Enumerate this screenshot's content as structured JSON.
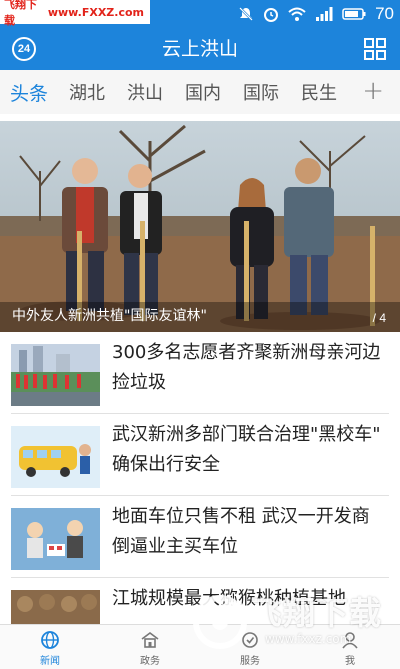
{
  "watermark_top": {
    "name": "飞翔下载",
    "url": "www.FXXZ.com"
  },
  "status_bar": {
    "battery": "70"
  },
  "header": {
    "title": "云上洪山",
    "badge": "24"
  },
  "tabs": [
    {
      "label": "头条",
      "active": true
    },
    {
      "label": "湖北"
    },
    {
      "label": "洪山"
    },
    {
      "label": "国内"
    },
    {
      "label": "国际"
    },
    {
      "label": "民生"
    }
  ],
  "tabs_more": "+",
  "hero": {
    "caption": "中外友人新洲共植\"国际友谊林\"",
    "index": "/ 4"
  },
  "news": [
    {
      "title": "300多名志愿者齐聚新洲母亲河边捡垃圾"
    },
    {
      "title": "武汉新洲多部门联合治理\"黑校车\" 确保出行安全"
    },
    {
      "title": "地面车位只售不租 武汉一开发商倒逼业主买车位"
    },
    {
      "title": "江城规模最大猕猴桃种植基地"
    }
  ],
  "bottom_nav": [
    {
      "label": "新闻",
      "icon": "globe-icon",
      "active": true
    },
    {
      "label": "政务",
      "icon": "building-icon"
    },
    {
      "label": "服务",
      "icon": "service-icon"
    },
    {
      "label": "我",
      "icon": "person-icon"
    }
  ],
  "watermark_big": {
    "text": "飞翔下载",
    "url": "www.fxxz.com"
  },
  "colors": {
    "primary": "#1d84db",
    "tab_bg": "#f6f6f6"
  }
}
